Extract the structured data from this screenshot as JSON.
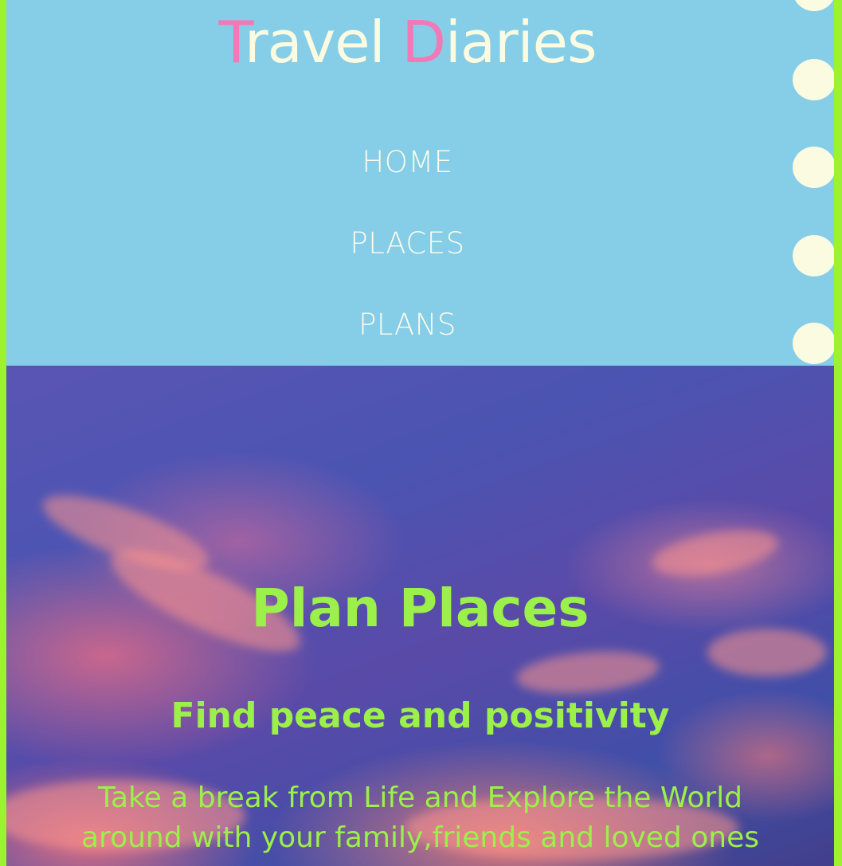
{
  "header": {
    "title_first_initial": "T",
    "title_first_rest": "ravel",
    "title_second_initial": "D",
    "title_second_rest": "iaries",
    "title_color": "#fafbe0",
    "title_accent_color": "#f278b6",
    "background_color": "#86cde8"
  },
  "nav": {
    "items": [
      {
        "label": "HOME"
      },
      {
        "label": "PLACES"
      },
      {
        "label": "PLANS"
      }
    ]
  },
  "hero": {
    "title": "Plan Places",
    "subtitle": "Find peace and positivity",
    "text": "Take a break from Life and Explore the World around with your family,friends and loved ones",
    "text_color": "#9cf04a"
  },
  "page": {
    "border_color": "#9cf22e"
  }
}
